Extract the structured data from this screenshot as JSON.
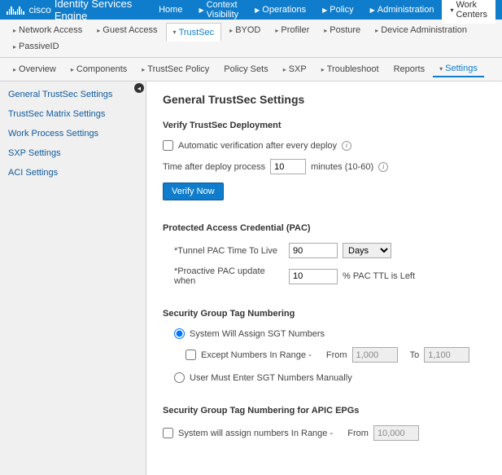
{
  "header": {
    "brand": "cisco",
    "appTitle": "Identity Services Engine",
    "nav": [
      {
        "label": "Home"
      },
      {
        "label": "Context Visibility"
      },
      {
        "label": "Operations"
      },
      {
        "label": "Policy"
      },
      {
        "label": "Administration"
      },
      {
        "label": "Work Centers"
      }
    ]
  },
  "subnav1": [
    {
      "label": "Network Access"
    },
    {
      "label": "Guest Access"
    },
    {
      "label": "TrustSec"
    },
    {
      "label": "BYOD"
    },
    {
      "label": "Profiler"
    },
    {
      "label": "Posture"
    },
    {
      "label": "Device Administration"
    },
    {
      "label": "PassiveID"
    }
  ],
  "subnav2": [
    {
      "label": "Overview"
    },
    {
      "label": "Components"
    },
    {
      "label": "TrustSec Policy"
    },
    {
      "label": "Policy Sets"
    },
    {
      "label": "SXP"
    },
    {
      "label": "Troubleshoot"
    },
    {
      "label": "Reports"
    },
    {
      "label": "Settings"
    }
  ],
  "sidebar": {
    "items": [
      {
        "label": "General TrustSec Settings"
      },
      {
        "label": "TrustSec Matrix Settings"
      },
      {
        "label": "Work Process Settings"
      },
      {
        "label": "SXP Settings"
      },
      {
        "label": "ACI Settings"
      }
    ]
  },
  "page": {
    "title": "General TrustSec Settings",
    "verify": {
      "title": "Verify TrustSec Deployment",
      "autoLabel": "Automatic verification after every deploy",
      "timeLabel": "Time after deploy process",
      "timeValue": "10",
      "timeUnits": "minutes (10-60)",
      "button": "Verify Now"
    },
    "pac": {
      "title": "Protected Access Credential (PAC)",
      "ttlLabel": "*Tunnel PAC Time To Live",
      "ttlValue": "90",
      "ttlUnit": "Days",
      "proactiveLabel": "*Proactive PAC update when",
      "proactiveValue": "10",
      "proactiveSuffix": "% PAC TTL is Left"
    },
    "sgt": {
      "title": "Security Group Tag Numbering",
      "opt1": "System Will Assign SGT Numbers",
      "exceptLabel": "Except Numbers In Range -",
      "fromLabel": "From",
      "fromValue": "1,000",
      "toLabel": "To",
      "toValue": "1,100",
      "opt2": "User Must Enter SGT Numbers Manually"
    },
    "apic": {
      "title": "Security Group Tag Numbering for APIC EPGs",
      "checkLabel": "System will assign numbers In Range -",
      "fromLabel": "From",
      "fromValue": "10,000"
    }
  }
}
